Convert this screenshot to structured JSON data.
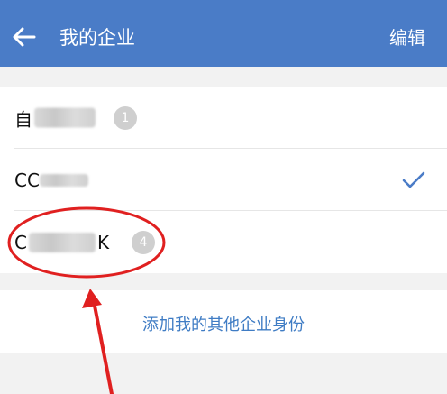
{
  "header": {
    "title": "我的企业",
    "edit_label": "编辑"
  },
  "companies": [
    {
      "prefix": "自",
      "suffix": "",
      "badge": "1",
      "selected": false
    },
    {
      "prefix": "CC",
      "suffix": "",
      "badge": "",
      "selected": true
    },
    {
      "prefix": "C",
      "suffix": "K",
      "badge": "4",
      "selected": false
    }
  ],
  "add_identity_label": "添加我的其他企业身份",
  "colors": {
    "header_bg": "#4a7cc7",
    "link": "#3f7cc4",
    "annotation": "#e02020"
  }
}
